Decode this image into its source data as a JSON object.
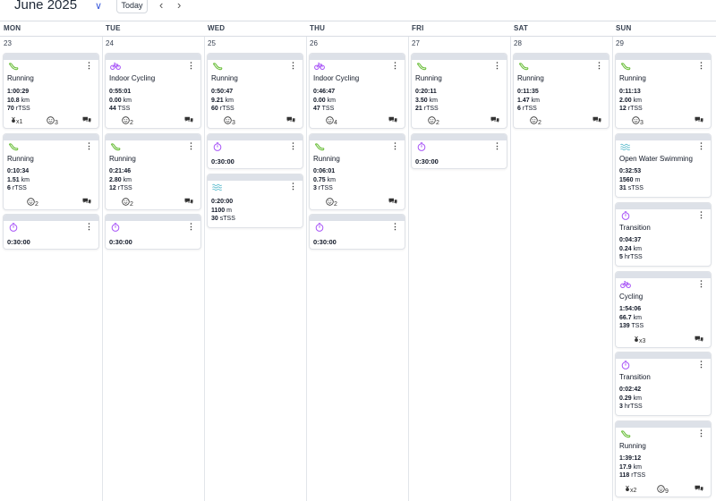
{
  "header": {
    "month": "June 2025",
    "today_label": "Today",
    "prev_icon": "chevron-left-icon",
    "next_icon": "chevron-right-icon",
    "dropdown_icon": "chevron-down-icon"
  },
  "days": [
    {
      "name": "MON",
      "num": "23"
    },
    {
      "name": "TUE",
      "num": "24"
    },
    {
      "name": "WED",
      "num": "25"
    },
    {
      "name": "THU",
      "num": "26"
    },
    {
      "name": "FRI",
      "num": "27"
    },
    {
      "name": "SAT",
      "num": "28"
    },
    {
      "name": "SUN",
      "num": "29"
    }
  ],
  "colors": {
    "run": "#6cbf3c",
    "bike": "#a855f7",
    "swim": "#4fb6c9",
    "timer": "#a855f7"
  },
  "workouts": {
    "mon_1": {
      "title": "Running",
      "time": "1:00:29",
      "dist": "10.8",
      "dist_unit": "km",
      "load": "70",
      "load_unit": "rTSS",
      "medal": "x1",
      "smile": "3"
    },
    "mon_2": {
      "title": "Running",
      "time": "0:10:34",
      "dist": "1.51",
      "dist_unit": "km",
      "load": "6",
      "load_unit": "rTSS",
      "smile": "2"
    },
    "mon_3": {
      "time": "0:30:00"
    },
    "tue_1": {
      "title": "Indoor Cycling",
      "time": "0:55:01",
      "dist": "0.00",
      "dist_unit": "km",
      "load": "44",
      "load_unit": "TSS",
      "smile": "2"
    },
    "tue_2": {
      "title": "Running",
      "time": "0:21:46",
      "dist": "2.80",
      "dist_unit": "km",
      "load": "12",
      "load_unit": "rTSS",
      "smile": "2"
    },
    "tue_3": {
      "time": "0:30:00"
    },
    "wed_1": {
      "title": "Running",
      "time": "0:50:47",
      "dist": "9.21",
      "dist_unit": "km",
      "load": "60",
      "load_unit": "rTSS",
      "smile": "3"
    },
    "wed_2": {
      "time": "0:30:00"
    },
    "wed_3": {
      "time": "0:20:00",
      "dist": "1100",
      "dist_unit": "m",
      "load": "30",
      "load_unit": "sTSS"
    },
    "thu_1": {
      "title": "Indoor Cycling",
      "time": "0:46:47",
      "dist": "0.00",
      "dist_unit": "km",
      "load": "47",
      "load_unit": "TSS",
      "smile": "4"
    },
    "thu_2": {
      "title": "Running",
      "time": "0:06:01",
      "dist": "0.75",
      "dist_unit": "km",
      "load": "3",
      "load_unit": "rTSS",
      "smile": "2"
    },
    "thu_3": {
      "time": "0:30:00"
    },
    "fri_1": {
      "title": "Running",
      "time": "0:20:11",
      "dist": "3.50",
      "dist_unit": "km",
      "load": "21",
      "load_unit": "rTSS",
      "smile": "2"
    },
    "fri_2": {
      "time": "0:30:00"
    },
    "sat_1": {
      "title": "Running",
      "time": "0:11:35",
      "dist": "1.47",
      "dist_unit": "km",
      "load": "6",
      "load_unit": "rTSS",
      "smile": "2"
    },
    "sun_1": {
      "title": "Running",
      "time": "0:11:13",
      "dist": "2.00",
      "dist_unit": "km",
      "load": "12",
      "load_unit": "rTSS",
      "smile": "3"
    },
    "sun_2": {
      "title": "Open Water Swimming",
      "time": "0:32:53",
      "dist": "1560",
      "dist_unit": "m",
      "load": "31",
      "load_unit": "sTSS"
    },
    "sun_3": {
      "title": "Transition",
      "time": "0:04:37",
      "dist": "0.24",
      "dist_unit": "km",
      "load": "5",
      "load_unit": "hrTSS"
    },
    "sun_4": {
      "title": "Cycling",
      "time": "1:54:06",
      "dist": "66.7",
      "dist_unit": "km",
      "load": "139",
      "load_unit": "TSS",
      "medal": "x3"
    },
    "sun_5": {
      "title": "Transition",
      "time": "0:02:42",
      "dist": "0.29",
      "dist_unit": "km",
      "load": "3",
      "load_unit": "hrTSS"
    },
    "sun_6": {
      "title": "Running",
      "time": "1:39:12",
      "dist": "17.9",
      "dist_unit": "km",
      "load": "118",
      "load_unit": "rTSS",
      "medal": "x2",
      "smile": "9"
    }
  }
}
